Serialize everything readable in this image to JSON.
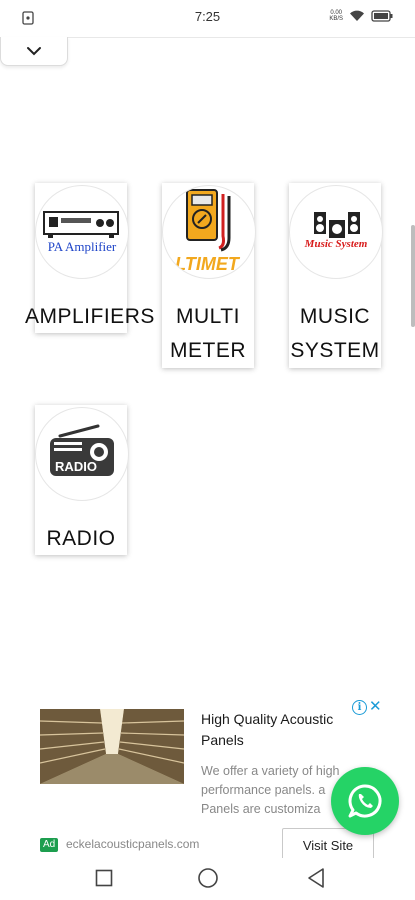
{
  "status_bar": {
    "time": "7:25",
    "speed_value": "0.00",
    "speed_unit": "KB/S",
    "icons": [
      "notification-icon",
      "wifi-icon",
      "battery-icon"
    ]
  },
  "collapse_icon": "chevron-down-icon",
  "categories": [
    {
      "label": "AMPLIFIERS",
      "logo_text": "PA Amplifier",
      "icon": "amplifier-icon"
    },
    {
      "label": "MULTI\nMETER",
      "logo_text": "LTIMET",
      "icon": "multimeter-icon"
    },
    {
      "label": "MUSIC\nSYSTEM",
      "logo_text": "Music System",
      "icon": "speakers-icon"
    },
    {
      "label": "RADIO",
      "logo_text": "RADIO",
      "icon": "radio-icon"
    }
  ],
  "ad": {
    "title": "High Quality Acoustic Panels",
    "description": "We offer a variety of high performance panels. a Panels are customiza",
    "badge": "Ad",
    "domain": "eckelacousticpanels.com",
    "cta": "Visit Site",
    "info_glyph": "i",
    "close_glyph": "✕"
  },
  "fab_icon": "whatsapp-icon",
  "nav": [
    "recents-square-icon",
    "home-circle-icon",
    "back-triangle-icon"
  ],
  "colors": {
    "accent_blue": "#1a9bd7",
    "ad_green": "#1d9e4f",
    "whatsapp_green": "#25d366"
  }
}
